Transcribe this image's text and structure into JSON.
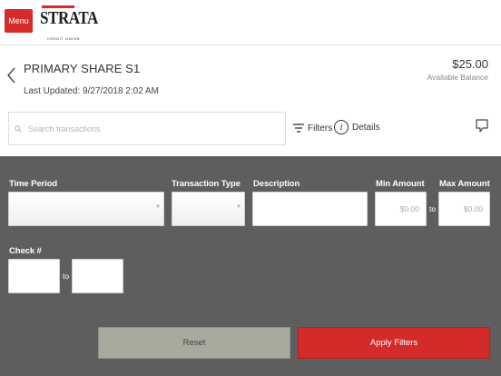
{
  "header": {
    "menu_label": "Menu",
    "logo": {
      "name": "STRATA",
      "tagline": "CREDIT UNION"
    }
  },
  "account": {
    "name": "PRIMARY SHARE S1",
    "last_updated": "Last Updated: 9/27/2018 2:02 AM",
    "balance": "$25.00",
    "balance_label": "Available Balance"
  },
  "toolbar": {
    "search_placeholder": "Search transactions",
    "search_value": "",
    "filters_label": "Filters",
    "details_label": "Details"
  },
  "filters": {
    "time_period_label": "Time Period",
    "time_period_value": "",
    "transaction_type_label": "Transaction Type",
    "transaction_type_value": "",
    "description_label": "Description",
    "description_value": "",
    "min_amount_label": "Min Amount",
    "min_amount_placeholder": "$0.00",
    "max_amount_label": "Max Amount",
    "max_amount_placeholder": "$0.00",
    "amount_to": "to",
    "check_label": "Check #",
    "check_to": "to",
    "check_from_value": "",
    "check_to_value": "",
    "reset_label": "Reset",
    "apply_label": "Apply Filters"
  },
  "colors": {
    "accent": "#d62b2b",
    "panel": "#5e5e5e",
    "reset_button": "#a7ab9e"
  },
  "icons": [
    "chevron-left-icon",
    "search-icon",
    "filter-lines-icon",
    "info-icon",
    "chat-bubble-icon",
    "select-caret-icon"
  ]
}
